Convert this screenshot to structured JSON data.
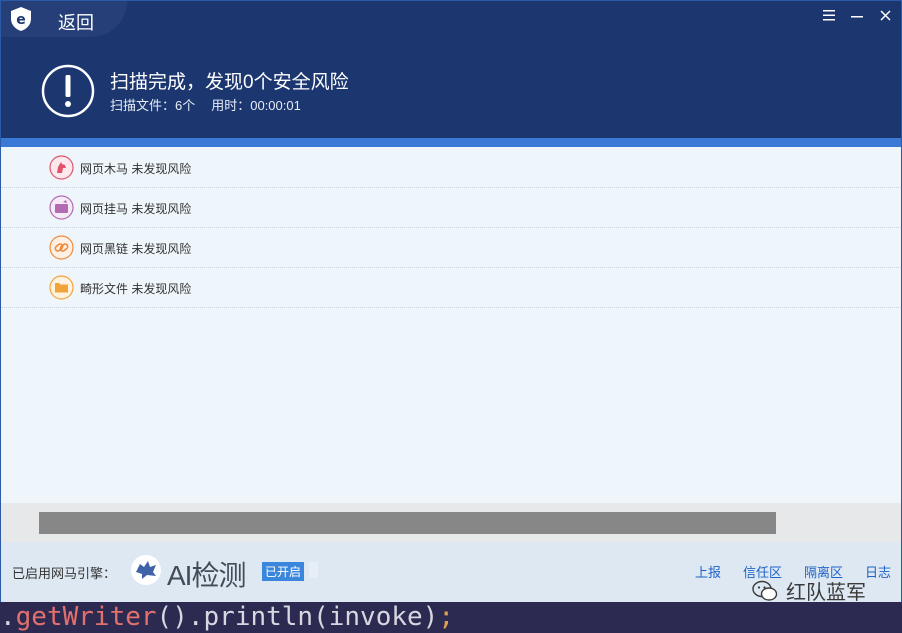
{
  "header": {
    "back_label": "返回",
    "result_title": "扫描完成，发现0个安全风险",
    "files_scanned": "扫描文件：6个",
    "time_used": "用时：00:00:01"
  },
  "window_controls": [
    "menu-icon",
    "minimize-icon",
    "close-icon"
  ],
  "scan_items": [
    {
      "label": "网页木马 未发现风险",
      "icon": "trojan-icon",
      "color": "#e0536b"
    },
    {
      "label": "网页挂马 未发现风险",
      "icon": "hanging-horse-icon",
      "color": "#b26ab2"
    },
    {
      "label": "网页黑链 未发现风险",
      "icon": "black-link-icon",
      "color": "#ef8a3c"
    },
    {
      "label": "畸形文件 未发现风险",
      "icon": "malformed-file-icon",
      "color": "#f0a43a"
    }
  ],
  "footer": {
    "engine_label": "已启用网马引擎：",
    "ai_text": "AI检测",
    "enabled_badge": "已开启",
    "links": [
      "上报",
      "信任区",
      "隔离区",
      "日志"
    ]
  },
  "watermark": {
    "text": "红队蓝军"
  },
  "code_line": {
    "dot": ".",
    "fn": "getWriter",
    "rest": "().println(invoke)",
    "semi": ";"
  },
  "colors": {
    "header_bg": "#1c3670",
    "accent_blue": "#3a79d5",
    "link_blue": "#1f63c8"
  }
}
